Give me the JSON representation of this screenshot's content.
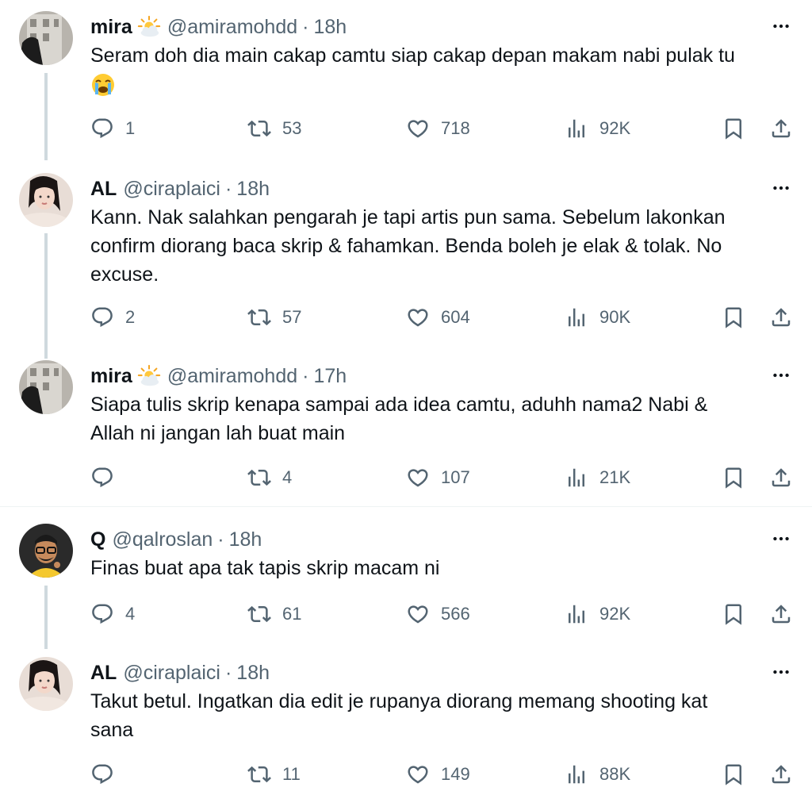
{
  "tweets": [
    {
      "name": "mira",
      "handle": "@amiramohdd",
      "sep": "·",
      "time": "18h",
      "has_name_emoji": true,
      "body": "Seram doh dia main cakap camtu siap cakap depan makam nabi pulak tu",
      "has_body_emoji": true,
      "replies": "1",
      "retweets": "53",
      "likes": "718",
      "views": "92K",
      "avatar": "building-photo"
    },
    {
      "name": "AL",
      "handle": "@ciraplaici",
      "sep": "·",
      "time": "18h",
      "has_name_emoji": false,
      "body": "Kann. Nak salahkan pengarah je tapi artis pun sama. Sebelum lakonkan\nconfirm diorang baca skrip & fahamkan. Benda boleh je elak & tolak. No\nexcuse.",
      "has_body_emoji": false,
      "replies": "2",
      "retweets": "57",
      "likes": "604",
      "views": "90K",
      "avatar": "woman-photo"
    },
    {
      "name": "mira",
      "handle": "@amiramohdd",
      "sep": "·",
      "time": "17h",
      "has_name_emoji": true,
      "body": "Siapa tulis skrip kenapa sampai ada idea camtu, aduhh nama2 Nabi &\nAllah ni jangan lah buat main",
      "has_body_emoji": false,
      "replies": "",
      "retweets": "4",
      "likes": "107",
      "views": "21K",
      "avatar": "building-photo"
    },
    {
      "name": "Q",
      "handle": "@qalroslan",
      "sep": "·",
      "time": "18h",
      "has_name_emoji": false,
      "body": "Finas buat apa tak tapis skrip macam ni",
      "has_body_emoji": false,
      "replies": "4",
      "retweets": "61",
      "likes": "566",
      "views": "92K",
      "avatar": "cartoon-man"
    },
    {
      "name": "AL",
      "handle": "@ciraplaici",
      "sep": "·",
      "time": "18h",
      "has_name_emoji": false,
      "body": "Takut betul. Ingatkan dia edit je rupanya diorang memang shooting kat\nsana",
      "has_body_emoji": false,
      "replies": "",
      "retweets": "11",
      "likes": "149",
      "views": "88K",
      "avatar": "woman-photo"
    }
  ],
  "icons": {
    "more": "more-icon",
    "reply": "reply-icon",
    "retweet": "retweet-icon",
    "like": "like-icon",
    "views": "views-icon",
    "bookmark": "bookmark-icon",
    "share": "share-icon",
    "name_emoji": "sun-behind-cloud-icon",
    "body_emoji": "crying-face-icon"
  },
  "colors": {
    "text": "#0f1419",
    "muted": "#536471",
    "line": "#cfd9de",
    "divider": "#eff3f4"
  }
}
